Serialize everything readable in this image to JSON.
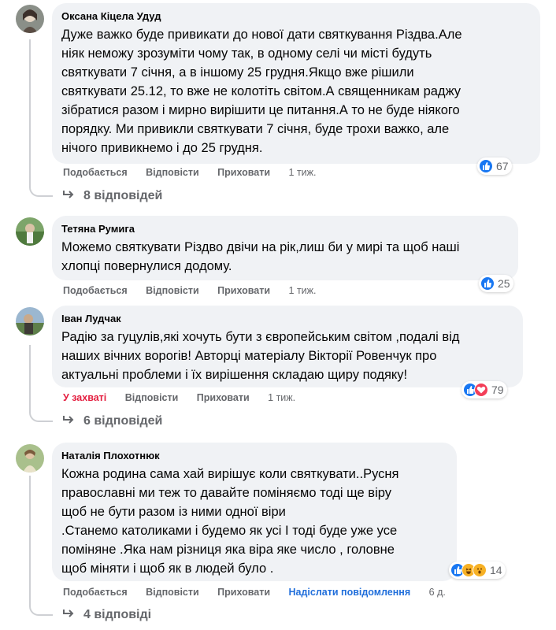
{
  "comments": [
    {
      "author": "Оксана Кіцела Удуд",
      "text": "Дуже важко буде привикати до нової дати святкування Різдва.Але\nніяк неможу зрозуміти чому так, в одному селі чи місті будуть\nсвяткувати 7 січня, а в іншому 25 грудня.Якщо вже рішили\nсвяткувати 25.12, то вже не колотіть світом.А священникам раджу\nзібратися разом і мирно вирішити це питання.А то не буде ніякого\nпорядку. Ми привикли святкувати 7 січня, буде трохи важко, але\nнічого привикнемо і до 25 грудня.",
      "actions": {
        "like": "Подобається",
        "reply": "Відповісти",
        "hide": "Приховати",
        "time": "1 тиж."
      },
      "reaction_count": "67",
      "replies": "8 відповідей"
    },
    {
      "author": "Тетяна Румига",
      "text": "Можемо святкувати Різдво двічи на рік,лиш би у мирі та щоб наші\nхлопці повернулися додому.",
      "actions": {
        "like": "Подобається",
        "reply": "Відповісти",
        "hide": "Приховати",
        "time": "1 тиж."
      },
      "reaction_count": "25"
    },
    {
      "author": "Іван Лудчак",
      "text": "Радію за гуцулів,які хочуть бути з європейським світом ,подалі від\nнаших вічних ворогів! Авторці матеріалу Вікторії Ровенчук про\nактуальні проблеми і їх вирішення складаю щиру подяку!",
      "actions": {
        "like": "У захваті",
        "reply": "Відповісти",
        "hide": "Приховати",
        "time": "1 тиж."
      },
      "reaction_count": "79",
      "replies": "6 відповідей"
    },
    {
      "author": "Наталія Плохотнюк",
      "text": "Кожна родина сама хай вирішує коли святкувати..Русня\nправославні ми теж то давайте поміняємо тоді ще віру\nщоб не бути разом із ними одної віри\n.Станемо католиками і будемо як усі І тоді буде уже усе\nпоміняне .Яка нам різниця яка віра яке число , головне\nщоб міняти і щоб як в людей було .",
      "actions": {
        "like": "Подобається",
        "reply": "Відповісти",
        "hide": "Приховати",
        "send": "Надіслати повідомлення",
        "time": "6 д."
      },
      "reaction_count": "14",
      "replies": "4 відповіді"
    }
  ],
  "colors": {
    "bubble": "#f0f2f5",
    "secondary_text": "#65676b",
    "like_blue": "#1877f2",
    "love_red": "#e41e3f",
    "link_blue": "#216fdb"
  }
}
